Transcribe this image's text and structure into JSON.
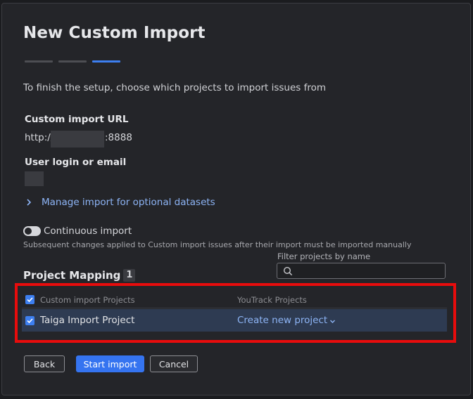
{
  "dialog": {
    "title": "New Custom Import",
    "steps": {
      "total": 3,
      "active": 3
    },
    "intro": "To finish the setup, choose which projects to import issues from"
  },
  "url_field": {
    "label": "Custom import URL",
    "prefix": "http://",
    "suffix": ":8888"
  },
  "login_field": {
    "label": "User login or email"
  },
  "optional": {
    "link": "Manage import for optional datasets"
  },
  "continuous": {
    "label": "Continuous import",
    "enabled": false,
    "help": "Subsequent changes applied to Custom import issues after their import must be imported manually"
  },
  "mapping": {
    "title": "Project Mapping",
    "count": "1",
    "filter": {
      "label": "Filter projects by name",
      "placeholder": ""
    },
    "columns": {
      "source": "Custom import Projects",
      "target": "YouTrack Projects"
    },
    "rows": [
      {
        "source": "Taiga Import Project",
        "target": "Create new project",
        "checked": true
      }
    ]
  },
  "buttons": {
    "back": "Back",
    "start": "Start import",
    "cancel": "Cancel"
  },
  "colors": {
    "accent": "#3574f0",
    "link": "#8db4f5",
    "highlight": "#e80c0c",
    "selected_row": "#2e3b52"
  },
  "icons": [
    "chevron-right-icon",
    "search-icon",
    "check-icon",
    "chevron-down-icon"
  ]
}
